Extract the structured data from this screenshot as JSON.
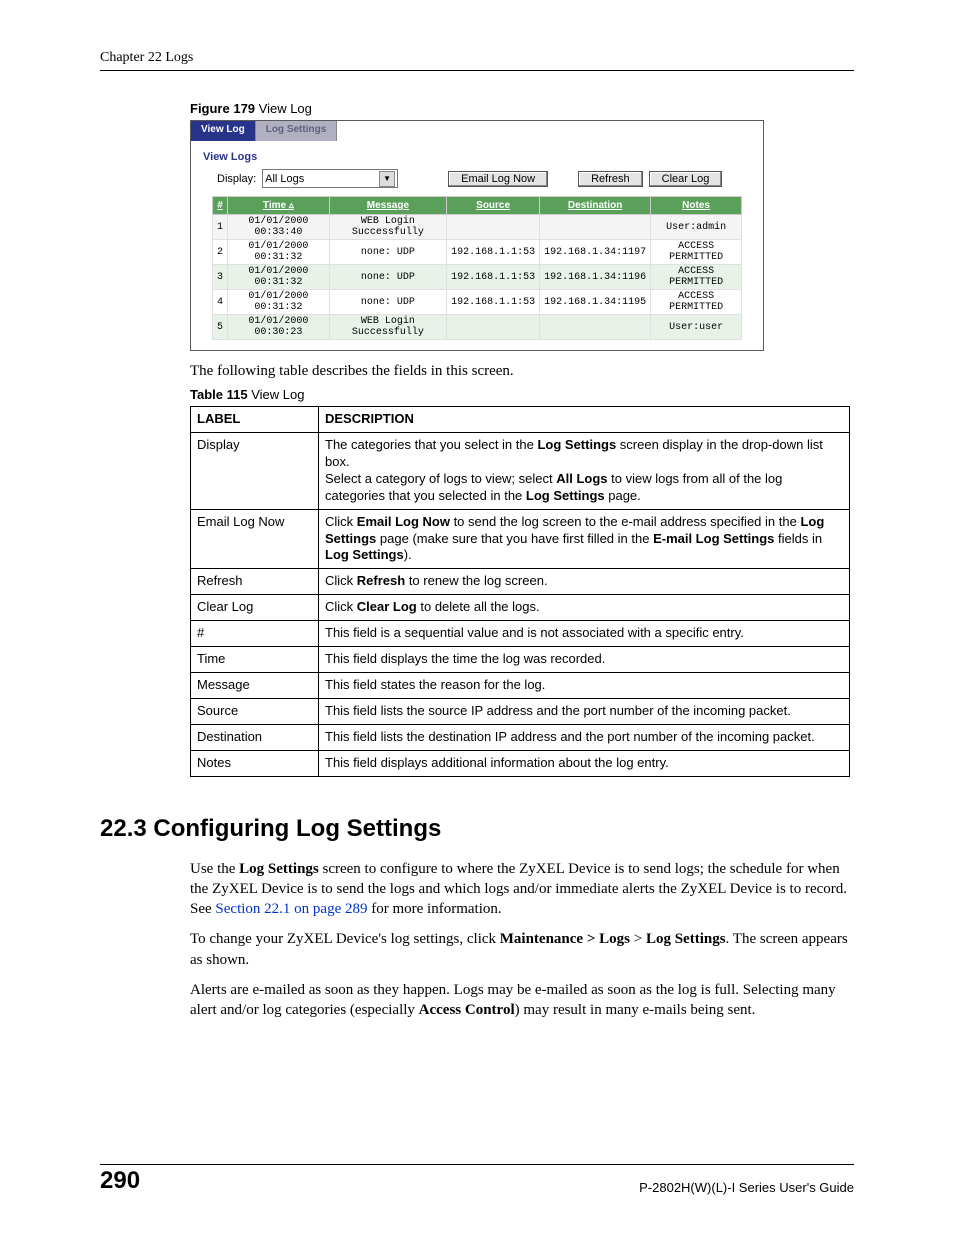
{
  "running_head": "Chapter 22 Logs",
  "figure_caption_bold": "Figure 179",
  "figure_caption_rest": "   View Log",
  "screenshot": {
    "tab_active": "View Log",
    "tab_inactive": "Log Settings",
    "panel_title": "View Logs",
    "display_label": "Display:",
    "display_value": "All Logs",
    "btn_email": "Email Log Now",
    "btn_refresh": "Refresh",
    "btn_clear": "Clear Log",
    "headers": {
      "num": "#",
      "time": "Time",
      "message": "Message",
      "source": "Source",
      "destination": "Destination",
      "notes": "Notes"
    },
    "rows": [
      {
        "n": "1",
        "time": "01/01/2000 00:33:40",
        "msg": "WEB Login Successfully",
        "src": "",
        "dst": "",
        "notes": "User:admin"
      },
      {
        "n": "2",
        "time": "01/01/2000 00:31:32",
        "msg": "none: UDP",
        "src": "192.168.1.1:53",
        "dst": "192.168.1.34:1197",
        "notes": "ACCESS PERMITTED"
      },
      {
        "n": "3",
        "time": "01/01/2000 00:31:32",
        "msg": "none: UDP",
        "src": "192.168.1.1:53",
        "dst": "192.168.1.34:1196",
        "notes": "ACCESS PERMITTED"
      },
      {
        "n": "4",
        "time": "01/01/2000 00:31:32",
        "msg": "none: UDP",
        "src": "192.168.1.1:53",
        "dst": "192.168.1.34:1195",
        "notes": "ACCESS PERMITTED"
      },
      {
        "n": "5",
        "time": "01/01/2000 00:30:23",
        "msg": "WEB Login Successfully",
        "src": "",
        "dst": "",
        "notes": "User:user"
      }
    ]
  },
  "intro_para": "The following table describes the fields in this screen.",
  "table_caption_bold": "Table 115",
  "table_caption_rest": "   View Log",
  "desc_header_label": "LABEL",
  "desc_header_desc": "DESCRIPTION",
  "desc_rows": {
    "r0_label": "Display",
    "r1_label": "Email Log Now",
    "r2_label": "Refresh",
    "r3_label": "Clear Log",
    "r4_label": "#",
    "r5_label": "Time",
    "r6_label": "Message",
    "r7_label": "Source",
    "r8_label": "Destination",
    "r9_label": "Notes"
  },
  "desc_text": {
    "r0a1": "The categories that you select in the ",
    "r0a2_b": "Log Settings",
    "r0a3": " screen display in the drop-down list box.",
    "r0b1": "Select a category of logs to view; select ",
    "r0b2_b": "All Logs",
    "r0b3": " to view logs from all of the log categories that you selected in the ",
    "r0b4_b": "Log Settings",
    "r0b5": " page.",
    "r1a": "Click ",
    "r1b_b": "Email Log Now",
    "r1c": " to send the log screen to the e-mail address specified in the ",
    "r1d_b": "Log Settings",
    "r1e": " page (make sure that you have first filled in the ",
    "r1f_b": "E-mail Log Settings",
    "r1g": " fields in ",
    "r1h_b": "Log Settings",
    "r1i": ").",
    "r2a": "Click ",
    "r2b_b": "Refresh",
    "r2c": " to renew the log screen.",
    "r3a": "Click ",
    "r3b_b": "Clear Log",
    "r3c": " to delete all the logs.",
    "r4": "This field is a sequential value and is not associated with a specific entry.",
    "r5": "This field displays the time the log was recorded.",
    "r6": "This field states the reason for the log.",
    "r7": "This field lists the source IP address and the port number of the incoming packet.",
    "r8": "This field lists the destination IP address and the port number of the incoming packet.",
    "r9": "This field displays additional information about the log entry."
  },
  "section_heading": "22.3  Configuring Log Settings",
  "p1a": "Use the ",
  "p1b_b": "Log Settings",
  "p1c": " screen to configure to where the ZyXEL Device is to send logs; the schedule for when the ZyXEL Device is to send the logs and which logs and/or immediate alerts the ZyXEL Device is to record. See ",
  "p1_link": "Section 22.1 on page 289",
  "p1d": " for more information.",
  "p2a": "To change your ZyXEL Device's log settings, click ",
  "p2b_b": "Maintenance > Logs",
  "p2c": " > ",
  "p2d_b": "Log Settings",
  "p2e": ". The screen appears as shown.",
  "p3a": "Alerts are e-mailed as soon as they happen. Logs may be e-mailed as soon as the log is full. Selecting many alert and/or log categories (especially ",
  "p3b_b": "Access Control",
  "p3c": ") may result in many e-mails being sent.",
  "page_number": "290",
  "footer_right": "P-2802H(W)(L)-I Series User's Guide"
}
